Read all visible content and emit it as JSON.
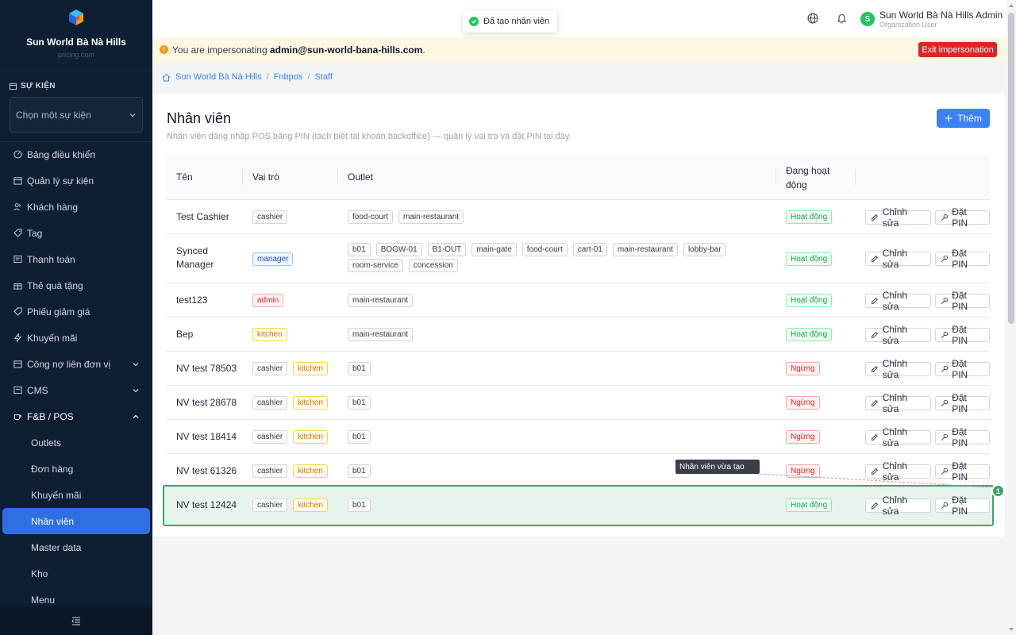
{
  "brand": {
    "name": "Sun World Bà Nà Hills",
    "sub": "pricing.com"
  },
  "event": {
    "section_label": "SỰ KIỆN",
    "placeholder": "Chọn một sự kiện"
  },
  "nav": [
    {
      "label": "Bảng điều khiển",
      "icon": "gauge-icon"
    },
    {
      "label": "Quản lý sự kiện",
      "icon": "calendar-icon"
    },
    {
      "label": "Khách hàng",
      "icon": "users-icon"
    },
    {
      "label": "Tag",
      "icon": "tag-icon"
    },
    {
      "label": "Thanh toán",
      "icon": "payment-icon"
    },
    {
      "label": "Thẻ quà tặng",
      "icon": "gift-icon"
    },
    {
      "label": "Phiếu giảm giá",
      "icon": "coupon-icon"
    },
    {
      "label": "Khuyến mãi",
      "icon": "flash-icon"
    },
    {
      "label": "Công nợ liên đơn vị",
      "icon": "debt-icon"
    },
    {
      "label": "CMS",
      "icon": "cms-icon"
    },
    {
      "label": "F&B / POS",
      "icon": "coffee-icon"
    }
  ],
  "nav_sub": [
    "Outlets",
    "Đơn hàng",
    "Khuyến mãi",
    "Nhân viên",
    "Master data",
    "Kho",
    "Menu"
  ],
  "toast": "Đã tạo nhân viên",
  "user": {
    "name": "Sun World Bà Nà Hills Admin",
    "role": "Organization User",
    "initial": "S"
  },
  "impersonation": {
    "prefix": "You are impersonating ",
    "email": "admin@sun-world-bana-hills.com",
    "suffix": ".",
    "exit": "Exit impersonation"
  },
  "breadcrumb": [
    "Sun World Bà Nà Hills",
    "Fnbpos",
    "Staff"
  ],
  "page": {
    "title": "Nhân viên",
    "description": "Nhân viên đăng nhập POS bằng PIN (tách biệt tài khoản backoffice) — quản lý vai trò và đặt PIN tại đây.",
    "add": "Thêm"
  },
  "table": {
    "headers": {
      "name": "Tên",
      "role": "Vai trò",
      "outlet": "Outlet",
      "active_1": "Đang hoạt",
      "active_2": "động"
    },
    "edit_label": "Chỉnh sửa",
    "pin_label": "Đặt PIN",
    "rows": [
      {
        "name": "Test Cashier",
        "roles": [
          "cashier"
        ],
        "outlets": [
          "food-court",
          "main-restaurant"
        ],
        "status": "Hoạt động"
      },
      {
        "name": "Synced Manager",
        "roles": [
          "manager"
        ],
        "outlets": [
          "b01",
          "BOGW-01",
          "B1-OUT",
          "main-gate",
          "food-court",
          "cart-01",
          "main-restaurant",
          "lobby-bar",
          "room-service",
          "concession"
        ],
        "status": "Hoạt động"
      },
      {
        "name": "test123",
        "roles": [
          "admin"
        ],
        "outlets": [
          "main-restaurant"
        ],
        "status": "Hoạt động"
      },
      {
        "name": "Bep",
        "roles": [
          "kitchen"
        ],
        "outlets": [
          "main-restaurant"
        ],
        "status": "Hoạt động"
      },
      {
        "name": "NV test 78503",
        "roles": [
          "cashier",
          "kitchen"
        ],
        "outlets": [
          "b01"
        ],
        "status": "Ngừng"
      },
      {
        "name": "NV test 28678",
        "roles": [
          "cashier",
          "kitchen"
        ],
        "outlets": [
          "b01"
        ],
        "status": "Ngừng"
      },
      {
        "name": "NV test 18414",
        "roles": [
          "cashier",
          "kitchen"
        ],
        "outlets": [
          "b01"
        ],
        "status": "Ngừng"
      },
      {
        "name": "NV test 61326",
        "roles": [
          "cashier",
          "kitchen"
        ],
        "outlets": [
          "b01"
        ],
        "status": "Ngừng"
      },
      {
        "name": "NV test 12424",
        "roles": [
          "cashier",
          "kitchen"
        ],
        "outlets": [
          "b01"
        ],
        "status": "Hoạt động"
      }
    ]
  },
  "annotation": {
    "tooltip": "Nhân viên vừa tạo",
    "marker": "1"
  }
}
